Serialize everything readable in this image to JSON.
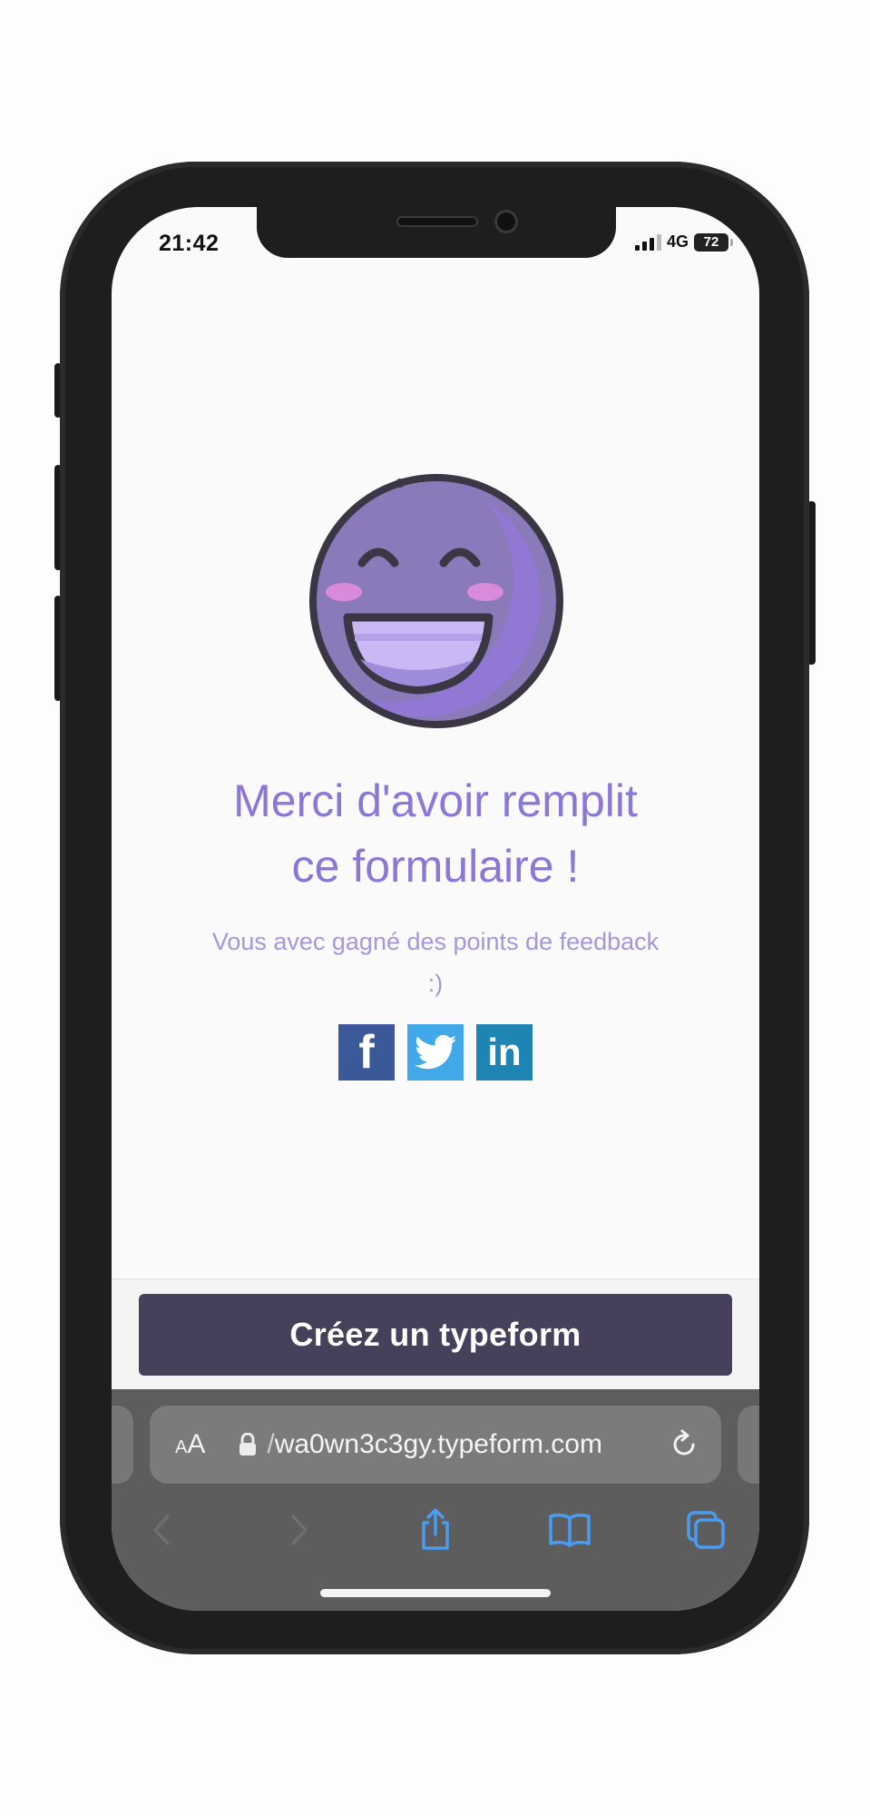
{
  "status_bar": {
    "time": "21:42",
    "network": "4G",
    "battery": "72"
  },
  "content": {
    "title_line1": "Merci d'avoir remplit",
    "title_line2": "ce formulaire !",
    "subtitle_line1": "Vous avec gagné des points de feedback",
    "subtitle_line2": ":)",
    "social": [
      {
        "name": "facebook",
        "glyph": "f",
        "color": "#3b5998"
      },
      {
        "name": "twitter",
        "icon": "twitter-bird-icon",
        "color": "#41a9e8"
      },
      {
        "name": "linkedin",
        "glyph": "in",
        "color": "#1e84b3"
      }
    ]
  },
  "cta": {
    "label": "Créez un typeform"
  },
  "browser": {
    "text_size_small": "A",
    "text_size_large": "A",
    "url_prefix": "/",
    "url": "wa0wn3c3gy.typeform.com",
    "accent": "#4a9cf2",
    "disabled": "#6e6e6e"
  }
}
